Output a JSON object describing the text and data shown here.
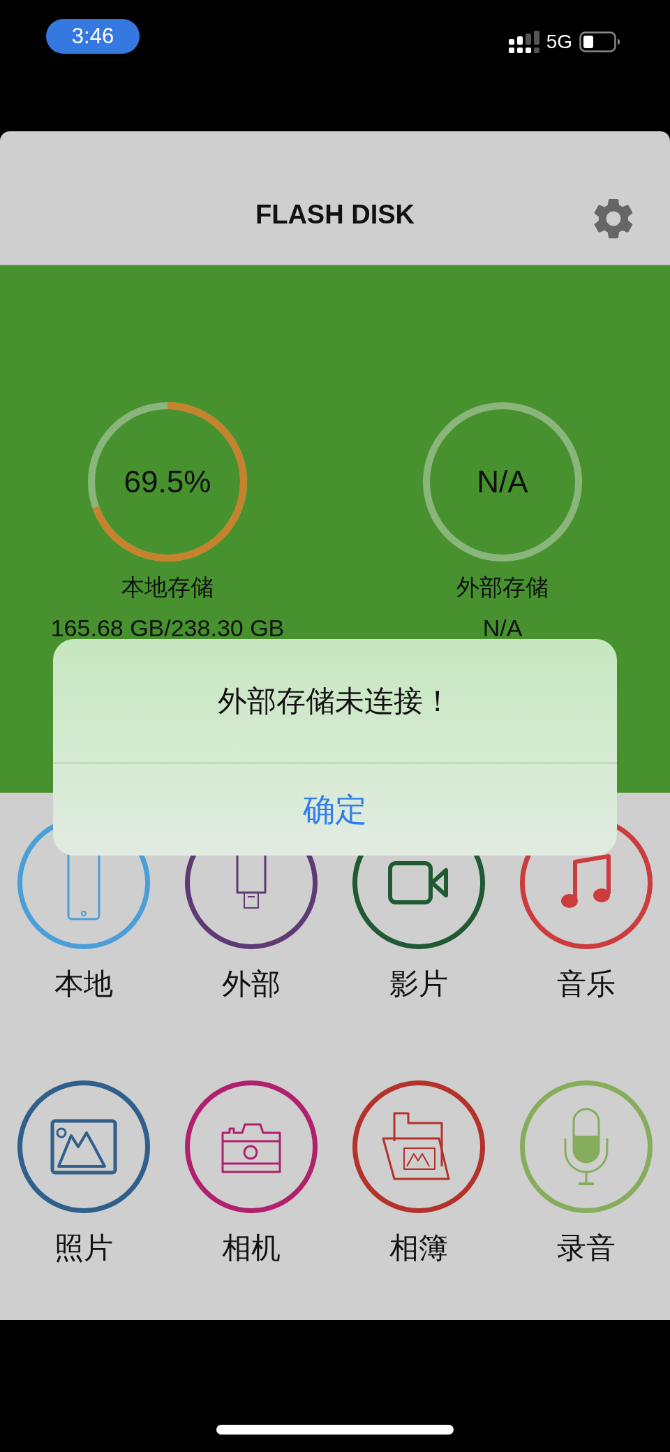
{
  "status_bar": {
    "time": "3:46",
    "network": "5G"
  },
  "header": {
    "title": "FLASH DISK"
  },
  "storage": [
    {
      "label": "本地存储",
      "percent": "69.5%",
      "usage": "165.68 GB/238.30 GB",
      "level": 0.695
    },
    {
      "label": "外部存储",
      "percent": "N/A",
      "usage": "N/A"
    }
  ],
  "alert": {
    "message": "外部存储未连接！",
    "button": "确定"
  },
  "shortcuts": [
    {
      "label": "本地",
      "kind": "phone",
      "color": "#4a9fd8"
    },
    {
      "label": "外部",
      "kind": "drive",
      "color": "#5e3a74"
    },
    {
      "label": "影片",
      "kind": "video",
      "color": "#1f5a32"
    },
    {
      "label": "音乐",
      "kind": "music",
      "color": "#cc3c3c"
    },
    {
      "label": "照片",
      "kind": "photo",
      "color": "#2f5f8a"
    },
    {
      "label": "相机",
      "kind": "camera",
      "color": "#b0206e"
    },
    {
      "label": "相簿",
      "kind": "album",
      "color": "#b4322a"
    },
    {
      "label": "录音",
      "kind": "mic",
      "color": "#86ad5c"
    }
  ]
}
